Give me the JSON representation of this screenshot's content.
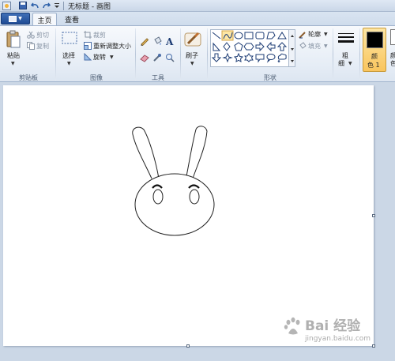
{
  "window": {
    "title": "无标题 - 画图",
    "quick_access": [
      "save-icon",
      "undo-icon",
      "redo-icon",
      "customize-dropdown-icon"
    ]
  },
  "tabs": [
    {
      "label": "主页",
      "active": true
    },
    {
      "label": "查看",
      "active": false
    }
  ],
  "ribbon": {
    "clipboard": {
      "group_label": "剪贴板",
      "paste_label": "粘贴",
      "cut_label": "剪切",
      "copy_label": "复制"
    },
    "image": {
      "group_label": "图像",
      "select_label": "选择",
      "crop_label": "裁剪",
      "resize_label": "重新调整大小",
      "rotate_label": "旋转"
    },
    "tools": {
      "group_label": "工具",
      "items": [
        "pencil-icon",
        "fill-icon",
        "text-icon",
        "eraser-icon",
        "color-picker-icon",
        "magnifier-icon"
      ]
    },
    "brushes": {
      "label": "刷子"
    },
    "shapes": {
      "group_label": "形状",
      "outline_label": "轮廓",
      "fill_label": "填充",
      "items": [
        "line",
        "curve",
        "oval",
        "rectangle",
        "rounded-rectangle",
        "polygon",
        "triangle",
        "right-triangle",
        "diamond",
        "pentagon",
        "hexagon",
        "right-arrow",
        "left-arrow",
        "up-arrow",
        "down-arrow",
        "four-point-star",
        "five-point-star",
        "six-point-star",
        "rounded-callout",
        "oval-callout",
        "cloud-callout"
      ],
      "selected": "curve"
    },
    "size": {
      "label_top": "粗",
      "label_bottom": "细"
    },
    "color1": {
      "label_top": "颜",
      "label_bottom": "色 1",
      "value": "#000000"
    },
    "color2_partial": {
      "label_top": "颜",
      "label_bottom": "色"
    }
  },
  "watermark": {
    "main": "Bai 经验",
    "sub": "jingyan.baidu.com"
  },
  "colors": {
    "accent": "#1f4b94",
    "ribbon_bg": "#e6edf6",
    "workspace_bg": "#cbd7e6",
    "color1_highlight": "#f9c55e"
  }
}
